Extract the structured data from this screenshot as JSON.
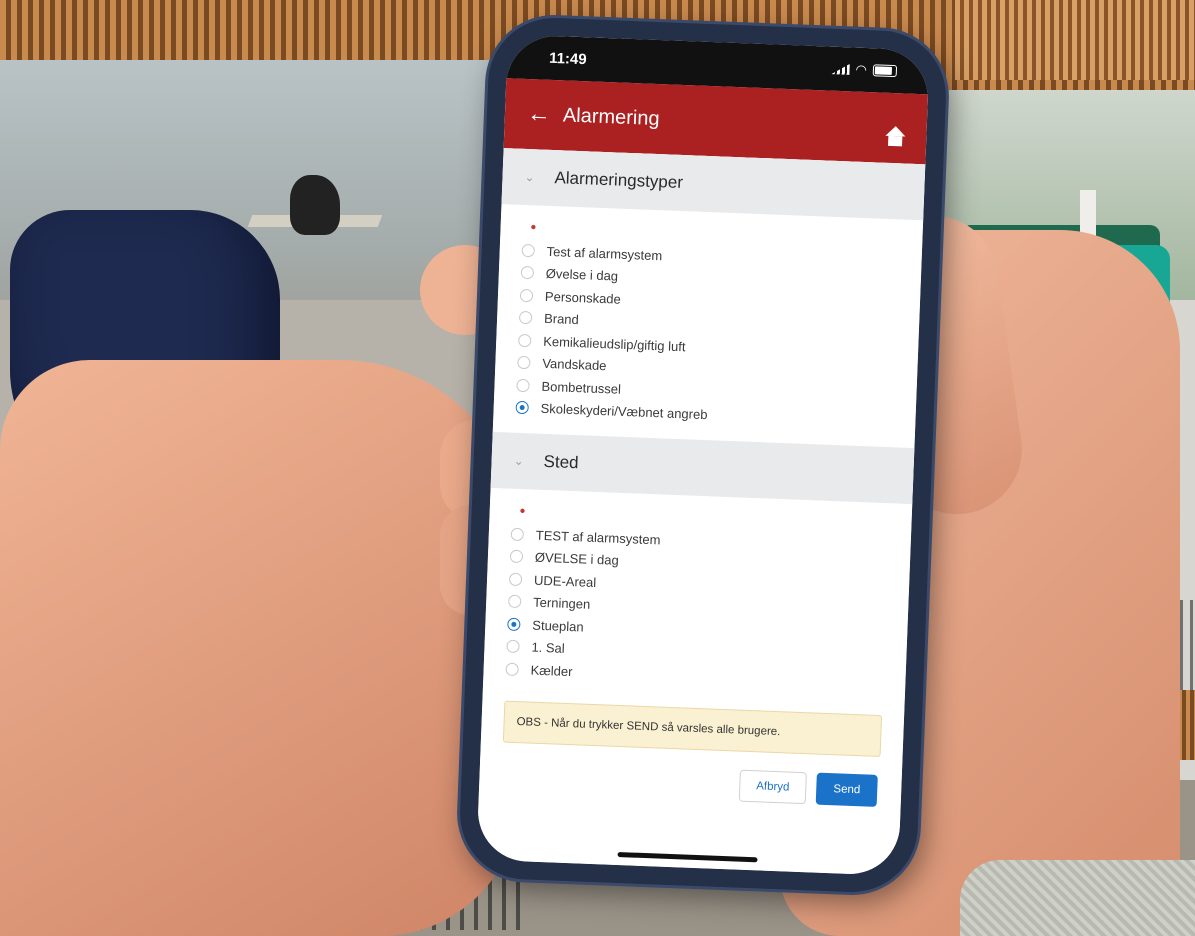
{
  "status_bar": {
    "time": "11:49"
  },
  "header": {
    "title": "Alarmering",
    "back_icon": "←"
  },
  "sections": {
    "alarm_types": {
      "title": "Alarmeringstyper",
      "required_marker": "•",
      "options": [
        {
          "label": "Test af alarmsystem",
          "checked": false
        },
        {
          "label": "Øvelse i dag",
          "checked": false
        },
        {
          "label": "Personskade",
          "checked": false
        },
        {
          "label": "Brand",
          "checked": false
        },
        {
          "label": "Kemikalieudslip/giftig luft",
          "checked": false
        },
        {
          "label": "Vandskade",
          "checked": false
        },
        {
          "label": "Bombetrussel",
          "checked": false
        },
        {
          "label": "Skoleskyderi/Væbnet angreb",
          "checked": true
        }
      ]
    },
    "location": {
      "title": "Sted",
      "required_marker": "•",
      "options": [
        {
          "label": "TEST af alarmsystem",
          "checked": false
        },
        {
          "label": "ØVELSE i dag",
          "checked": false
        },
        {
          "label": "UDE-Areal",
          "checked": false
        },
        {
          "label": "Terningen",
          "checked": false
        },
        {
          "label": "Stueplan",
          "checked": true
        },
        {
          "label": "1. Sal",
          "checked": false
        },
        {
          "label": "Kælder",
          "checked": false
        }
      ]
    }
  },
  "notice": {
    "text": "OBS - Når du trykker SEND så varsles alle brugere."
  },
  "actions": {
    "cancel_label": "Afbryd",
    "send_label": "Send"
  },
  "colors": {
    "header_red": "#ab2121",
    "accent_blue": "#1b72c9",
    "notice_bg": "#faf0d2"
  }
}
